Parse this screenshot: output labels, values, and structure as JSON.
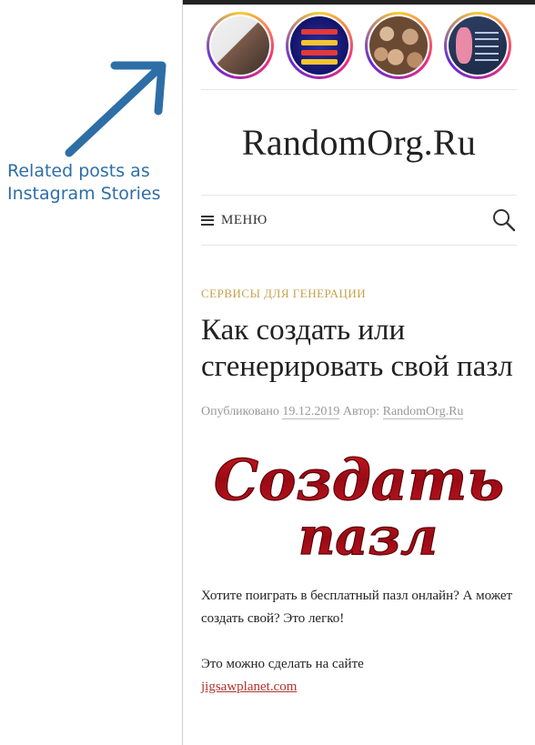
{
  "annotation": {
    "text_line1": "Related posts as",
    "text_line2": "Instagram Stories",
    "color": "#2e6ea6"
  },
  "stories": [
    {
      "name": "story-1"
    },
    {
      "name": "story-2"
    },
    {
      "name": "story-3"
    },
    {
      "name": "story-4"
    }
  ],
  "site": {
    "title": "RandomOrg.Ru"
  },
  "nav": {
    "menu_label": "МЕНЮ",
    "menu_icon": "hamburger-icon",
    "search_icon": "search-icon"
  },
  "article": {
    "category": "СЕРВИСЫ ДЛЯ ГЕНЕРАЦИИ",
    "title": "Как создать или сгенерировать свой пазл",
    "meta_published": "Опубликовано",
    "meta_date": "19.12.2019",
    "meta_author_label": "Автор:",
    "meta_author": "RandomOrg.Ru",
    "hero_line1": "Создать",
    "hero_line2": "пазл",
    "paragraph1": "Хотите поиграть в бесплатный пазл онлайн? А может создать свой? Это легко!",
    "paragraph2_text": "Это можно сделать на сайте",
    "paragraph2_link": "jigsawplanet.com"
  },
  "colors": {
    "category": "#c5a24a",
    "link": "#b3332a",
    "hero_red": "#b0101a"
  }
}
